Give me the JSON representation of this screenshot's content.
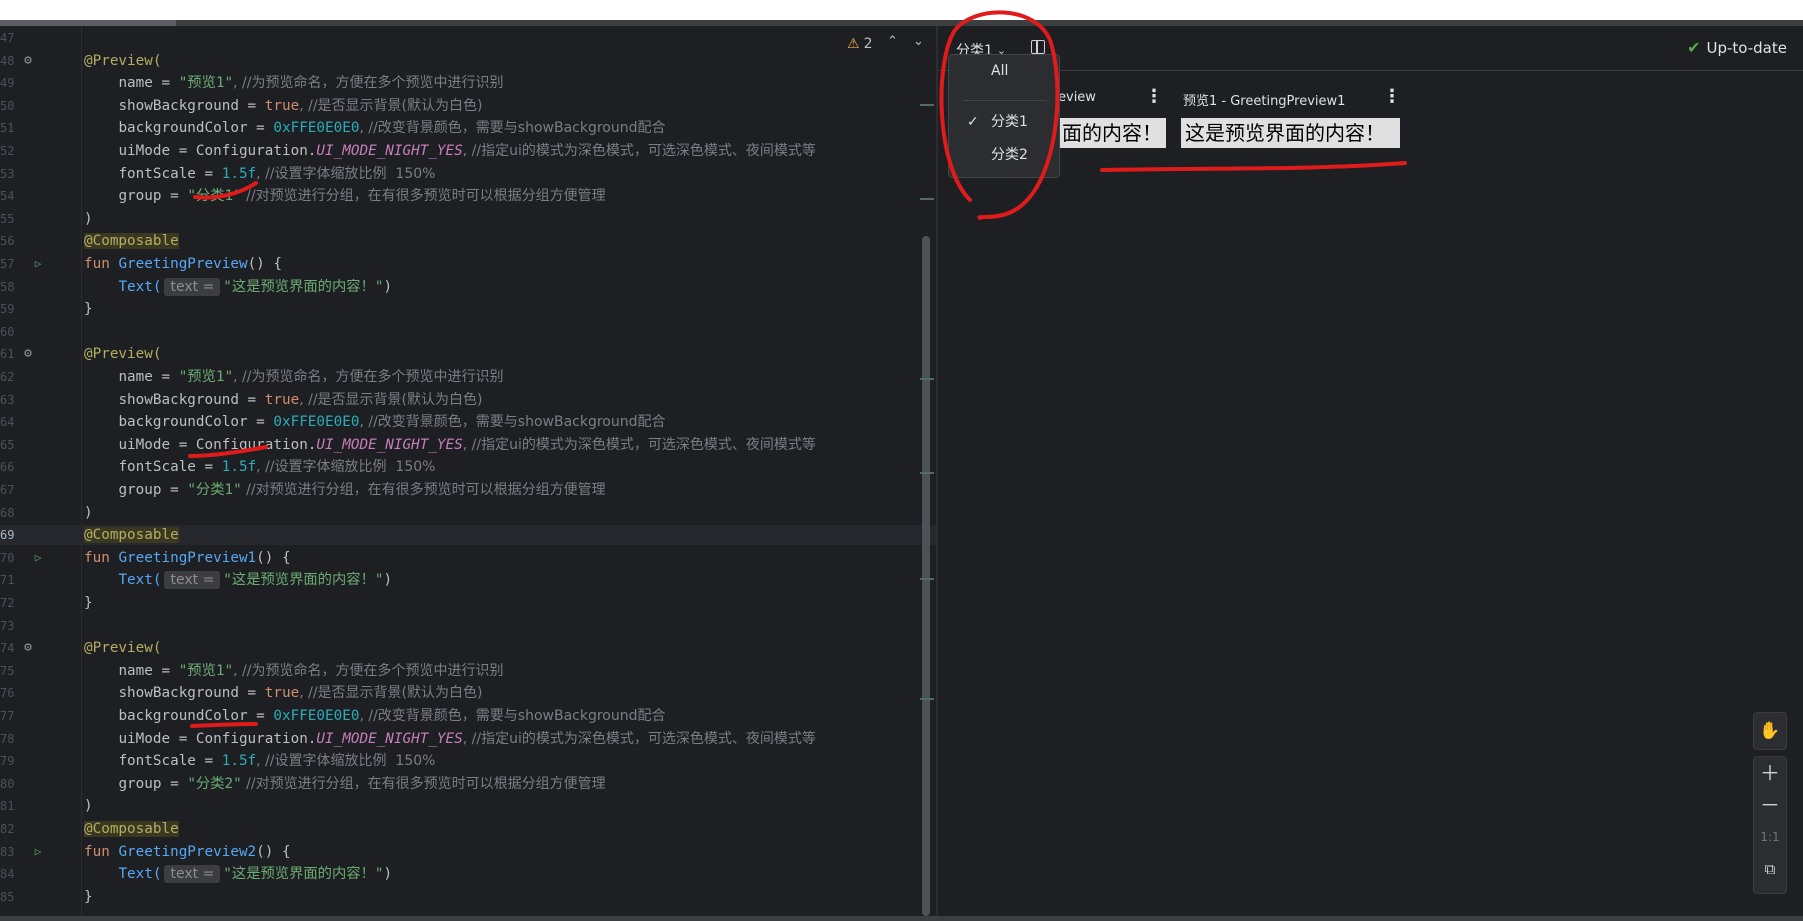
{
  "editor": {
    "line_numbers": [
      "47",
      "48",
      "49",
      "50",
      "51",
      "52",
      "53",
      "54",
      "55",
      "56",
      "57",
      "58",
      "59",
      "60",
      "61",
      "62",
      "63",
      "64",
      "65",
      "66",
      "67",
      "68",
      "69",
      "70",
      "71",
      "72",
      "73",
      "74",
      "75",
      "76",
      "77",
      "78",
      "79",
      "80",
      "81",
      "82",
      "83",
      "84",
      "85"
    ],
    "code": {
      "preview_ann": "@Preview(",
      "name_key": "name = ",
      "name_val": "\"预览1\"",
      "name_cmt": ", //为预览命名，方便在多个预览中进行识别",
      "showbg_key": "showBackground = ",
      "showbg_val": "true",
      "showbg_cmt": ", //是否显示背景(默认为白色)",
      "bgcolor_key": "backgroundColor = ",
      "bgcolor_val": "0xFFE0E0E0",
      "bgcolor_cmt": ", //改变背景颜色，需要与showBackground配合",
      "uimode_key": "uiMode = Configuration.",
      "uimode_val": "UI_MODE_NIGHT_YES",
      "uimode_cmt": ", //指定ui的模式为深色模式，可选深色模式、夜间模式等",
      "fontscale_key": "fontScale = ",
      "fontscale_val": "1.5f",
      "fontscale_cmt": ", //设置字体缩放比例  150%",
      "group_key": "group = ",
      "group1_val": "\"分类1\"",
      "group2_val": "\"分类2\"",
      "group1_cmt_a": " //对预览进行分组，在有很多预览时可以根据分组方便管理",
      "group1_cmt_b": " //对预览进行分组，在有很多预览时可以根据分组方便管理",
      "group2_cmt": " //对预览进行分组，在有很多预览时可以根据分组方便管理",
      "close_paren": ")",
      "composable": "@Composable",
      "fun_kw": "fun ",
      "fn1": "GreetingPreview",
      "fn2": "GreetingPreview1",
      "fn3": "GreetingPreview2",
      "fn_sig_end": "() {",
      "text_call": "Text(",
      "text_hint": "text =",
      "text_arg": "\"这是预览界面的内容！\"",
      "text_close": ")",
      "close_brace": "}"
    },
    "warnings": {
      "count": "2"
    }
  },
  "preview": {
    "group_selected": "分类1",
    "status": "Up-to-date",
    "card1_title": "eview",
    "card2_title": "预览1 - GreetingPreview1",
    "card1_text": "面的内容！",
    "card2_text": "这是预览界面的内容！",
    "menu": {
      "items": [
        {
          "label": "All",
          "checked": false
        },
        {
          "label": "分类1",
          "checked": true
        },
        {
          "label": "分类2",
          "checked": false
        }
      ],
      "checkmark": "✓"
    },
    "zoom": {
      "ratio": "1:1"
    }
  },
  "icons": {
    "warning": "warning-icon",
    "gear": "gear-icon",
    "run": "run-gutter-icon",
    "check": "check-icon",
    "hand": "pan-hand-icon",
    "plus": "zoom-in-icon",
    "minus": "zoom-out-icon",
    "fit": "zoom-fit-icon"
  },
  "colors": {
    "annotation": "#b3ae60",
    "string": "#6aab73",
    "keyword": "#cf8e6d",
    "number": "#2aacb8",
    "function": "#56a8f5",
    "constant": "#c77dbb",
    "marker_red": "#e01b1b",
    "status_green": "#57a64a"
  }
}
